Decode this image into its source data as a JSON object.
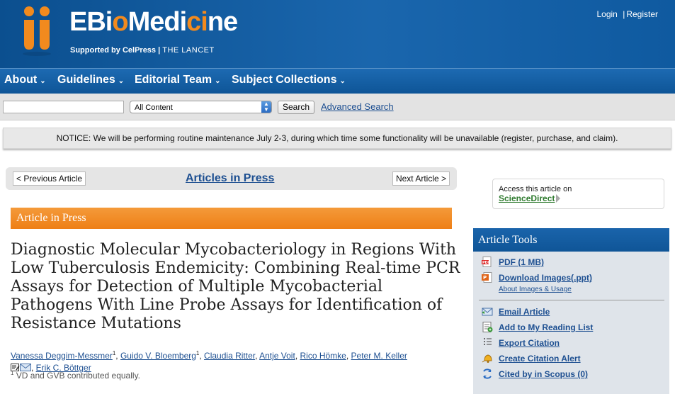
{
  "header": {
    "brand_prefix": "EBi",
    "brand_o": "o",
    "brand_mid": "Medi",
    "brand_c": "ci",
    "brand_suffix": "ne",
    "support_prefix": "Supported by",
    "support_cell": "CelPress",
    "support_sep": "|",
    "support_lancet": "THE LANCET",
    "login": "Login",
    "separator": "|",
    "register": "Register",
    "logo_color": "#f28a1e"
  },
  "nav": {
    "items": [
      {
        "label": "About"
      },
      {
        "label": "Guidelines"
      },
      {
        "label": "Editorial Team"
      },
      {
        "label": "Subject Collections"
      }
    ],
    "caret": "⌄"
  },
  "search": {
    "input_value": "",
    "select_value": "All Content",
    "button_label": "Search",
    "advanced_label": "Advanced Search"
  },
  "notice": {
    "text": "NOTICE: We will be performing routine maintenance July 2-3, during which time some functionality will be unavailable (register, purchase, and claim)."
  },
  "article_nav": {
    "previous": "< Previous Article",
    "center": "Articles in Press",
    "next": "Next Article >"
  },
  "article": {
    "status_bar": "Article in Press",
    "title": "Diagnostic Molecular Mycobacteriology in Regions With Low Tuberculosis Endemicity: Combining Real-time PCR Assays for Detection of Multiple Mycobacterial Pathogens With Line Probe Assays for Identification of Resistance Mutations",
    "authors": [
      {
        "name": "Vanessa Deggim-Messmer",
        "sup": "1"
      },
      {
        "name": "Guido V. Bloemberg",
        "sup": "1"
      },
      {
        "name": "Claudia Ritter",
        "sup": ""
      },
      {
        "name": "Antje Voit",
        "sup": ""
      },
      {
        "name": "Rico Hömke",
        "sup": ""
      },
      {
        "name": "Peter M. Keller",
        "sup": ""
      },
      {
        "name": "Erik C. Böttger",
        "sup": ""
      }
    ],
    "footnote_mark": "1",
    "footnote": "VD and GVB contributed equally."
  },
  "sidebar": {
    "access_label": "Access this article on",
    "access_link": "ScienceDirect",
    "tools_title": "Article Tools",
    "tools": [
      {
        "label": "PDF (1 MB)",
        "icon": "pdf-icon"
      },
      {
        "label": "Download Images(.ppt)",
        "icon": "ppt-icon"
      },
      {
        "label": "Email Article",
        "icon": "email-icon"
      },
      {
        "label": "Add to My Reading List",
        "icon": "reading-list-icon"
      },
      {
        "label": "Export Citation",
        "icon": "export-citation-icon"
      },
      {
        "label": "Create Citation Alert",
        "icon": "alert-icon"
      },
      {
        "label": "Cited by in Scopus (0)",
        "icon": "scopus-icon"
      }
    ],
    "about_images": "About Images & Usage"
  }
}
